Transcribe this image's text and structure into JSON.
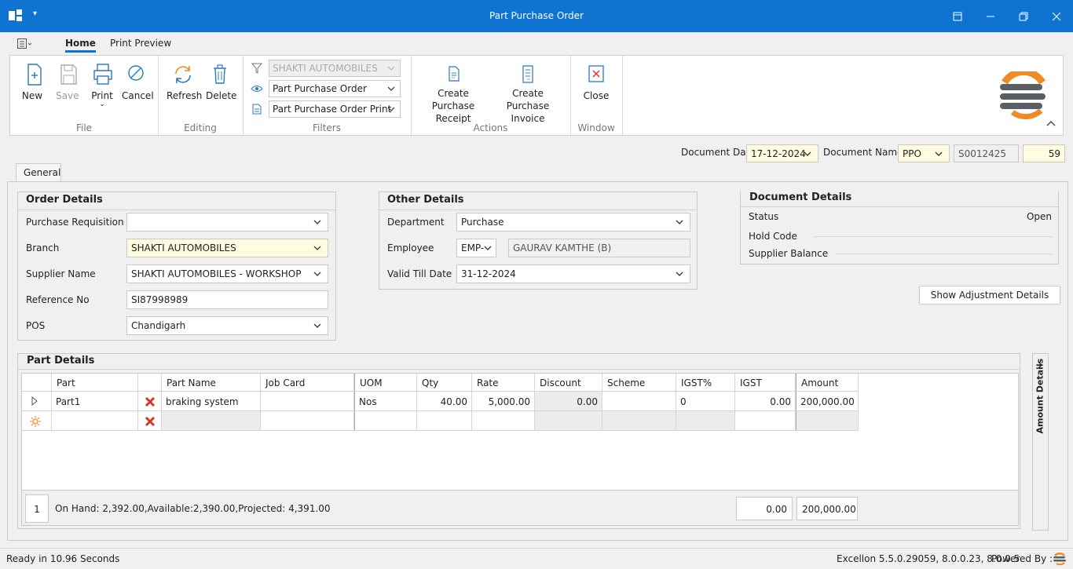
{
  "window": {
    "title": "Part Purchase Order"
  },
  "tabs": {
    "home": "Home",
    "print_preview": "Print Preview"
  },
  "ribbon": {
    "file": {
      "label": "File",
      "new": "New",
      "save": "Save",
      "print": "Print",
      "cancel": "Cancel"
    },
    "editing": {
      "label": "Editing",
      "refresh": "Refresh",
      "delete": "Delete"
    },
    "filters": {
      "label": "Filters",
      "company": "SHAKTI AUTOMOBILES",
      "view": "Part Purchase Order",
      "print_format": "Part Purchase Order Print"
    },
    "actions": {
      "label": "Actions",
      "receipt_line1": "Create Purchase",
      "receipt_line2": "Receipt",
      "invoice_line1": "Create Purchase",
      "invoice_line2": "Invoice"
    },
    "window": {
      "label": "Window",
      "close": "Close"
    }
  },
  "header": {
    "doc_date_label": "Document Date",
    "doc_date": "17-12-2024",
    "doc_name_label": "Document Name",
    "doc_name": "PPO",
    "doc_no": "S0012425",
    "doc_seq": "59"
  },
  "form_tab": "General",
  "order_details": {
    "title": "Order Details",
    "purchase_requisition_label": "Purchase Requisition",
    "purchase_requisition": "",
    "branch_label": "Branch",
    "branch": "SHAKTI AUTOMOBILES",
    "supplier_label": "Supplier Name",
    "supplier": "SHAKTI AUTOMOBILES - WORKSHOP",
    "reference_label": "Reference No",
    "reference": "SI87998989",
    "pos_label": "POS",
    "pos": "Chandigarh"
  },
  "other_details": {
    "title": "Other Details",
    "department_label": "Department",
    "department": "Purchase",
    "employee_label": "Employee",
    "employee_code": "EMP-",
    "employee_name": "GAURAV  KAMTHE (B)",
    "valid_till_label": "Valid Till Date",
    "valid_till": "31-12-2024"
  },
  "document_details": {
    "title": "Document Details",
    "status_label": "Status",
    "status": "Open",
    "hold_code_label": "Hold Code",
    "supplier_balance_label": "Supplier Balance"
  },
  "show_adjustment": "Show Adjustment Details",
  "part_details": {
    "title": "Part Details",
    "columns": [
      "Part",
      "Part Name",
      "Job Card",
      "UOM",
      "Qty",
      "Rate",
      "Discount",
      "Scheme",
      "IGST%",
      "IGST",
      "Amount"
    ],
    "rows": [
      {
        "part": "Part1",
        "part_name": "braking system",
        "job_card": "",
        "uom": "Nos",
        "qty": "40.00",
        "rate": "5,000.00",
        "discount": "0.00",
        "scheme": "",
        "igst_pct": "0",
        "igst": "0.00",
        "amount": "200,000.00"
      }
    ],
    "row_count": "1",
    "stock_info": "On Hand: 2,392.00,Available:2,390.00,Projected: 4,391.00",
    "total_igst": "0.00",
    "total_amount": "200,000.00",
    "side_panel": "Amount Details"
  },
  "statusbar": {
    "left": "Ready in 10.96 Seconds",
    "version": "Excellon 5.5.0.29059, 8.0.0.23, 8.0.0.5",
    "powered": "Powered By :"
  },
  "colors": {
    "titlebar": "#0f74d1",
    "highlight": "#fffce0",
    "accent_orange": "#f08a24",
    "delete_red": "#d9322a"
  }
}
